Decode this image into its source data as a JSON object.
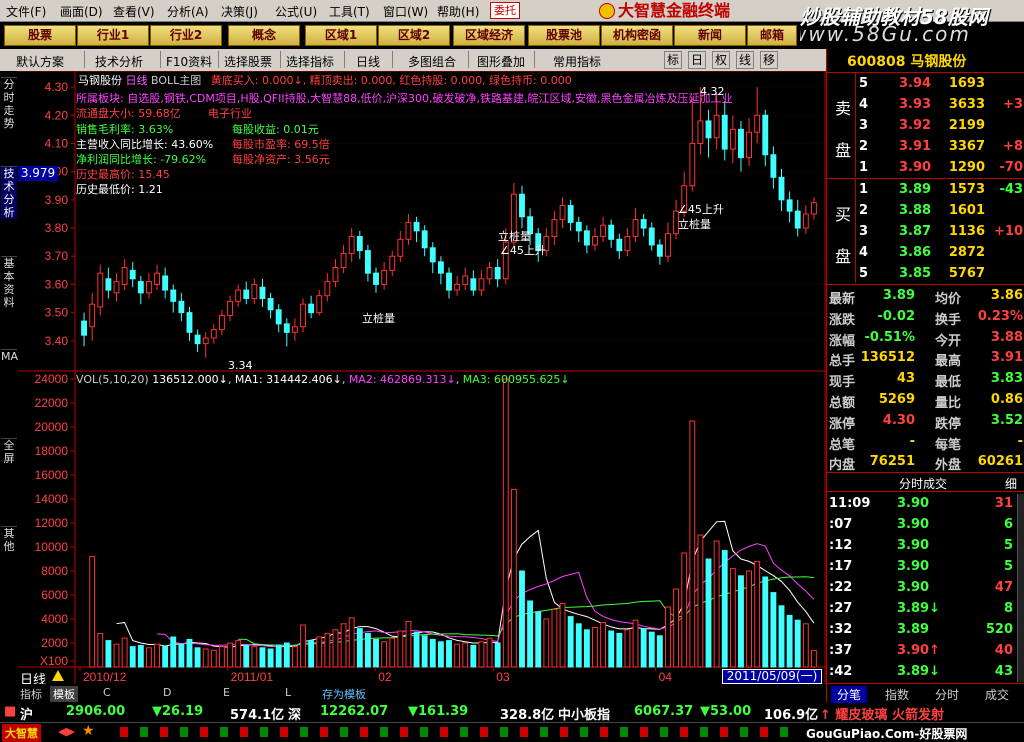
{
  "menu": [
    "文件(F)",
    "画面(D)",
    "查看(V)",
    "分析(A)",
    "决策(J)",
    "公式(U)",
    "工具(T)",
    "窗口(W)",
    "帮助(H)"
  ],
  "entrust_label": "委托",
  "brand_title": "大智慧金融终端",
  "watermark": {
    "line1": "炒股辅助教材58股网",
    "line2": "www.58Gu.com"
  },
  "func_buttons": [
    "股票",
    "行业1",
    "行业2",
    "概念",
    "区域1",
    "区域2",
    "区域经济",
    "股票池",
    "机构密函",
    "新闻",
    "邮箱"
  ],
  "toolbar": {
    "items": [
      "默认方案",
      "技术分析",
      "F10资料",
      "选择股票",
      "选择指标",
      "日线",
      "多图组合",
      "图形叠加",
      "常用指标"
    ],
    "toggles": [
      "标",
      "日",
      "权",
      "线",
      "移"
    ]
  },
  "left_tabs": [
    "分时走势",
    "技术分析",
    "基本资料",
    "MACD",
    "全屏",
    "其他"
  ],
  "chart_header": {
    "stock": "马钢股份",
    "period": "日线",
    "indicator": "BOLL主图",
    "signals": "黄底买入: 0.000↓, 精顶卖出: 0.000, 红色持股: 0.000, 绿色持币: 0.000"
  },
  "info_lines": {
    "sectors": "所属板块: 自选股,钢铁,CDM项目,H股,QFII持股,大智慧88,低价,沪深300,破发破净,铁路基建,皖江区域,安徽,黑色金属冶炼及压延加工业",
    "float_cap": "流通盘大小: 59.68亿",
    "tag": "电子行业",
    "gross_margin": "销售毛利率: 3.63%",
    "eps": "每股收益: 0.01元",
    "revenue_growth": "主营收入同比增长: 43.60%",
    "pe": "每股市盈率: 69.5倍",
    "profit_growth": "净利润同比增长: -79.62%",
    "nav": "每股净资产: 3.56元",
    "hist_high": "历史最高价: 15.45",
    "hist_low": "历史最低价: 1.21"
  },
  "current_price_tag": "3.979",
  "price_axis": [
    "4.30",
    "4.20",
    "4.10",
    "4.00",
    "3.90",
    "3.80",
    "3.70",
    "3.60",
    "3.50",
    "3.40"
  ],
  "vol_header": {
    "label": "VOL(5,10,20)",
    "value": "136512.000↓",
    "ma1": "MA1: 314442.406↓",
    "ma2": "MA2: 462869.313↓",
    "ma3": "MA3: 600955.625↓"
  },
  "vol_axis": [
    "24000",
    "22000",
    "20000",
    "18000",
    "16000",
    "14000",
    "12000",
    "10000",
    "8000",
    "6000",
    "4000",
    "2000",
    "X100"
  ],
  "chart_annotations": {
    "low_marker": "3.34",
    "high_marker": "4.32",
    "notes": [
      "立桩量",
      "立桩量",
      "∠45上升",
      "∠45上升",
      "立桩量"
    ]
  },
  "date_axis": [
    "2010/12",
    "2011/01",
    "02",
    "03",
    "04"
  ],
  "date_box": "2011/05/09(一)",
  "period_label": "日线",
  "bottom_tabs": [
    "指标",
    "模板",
    "C",
    "D",
    "E",
    "L",
    "存为模板"
  ],
  "ticker": {
    "sh_label": "沪",
    "sh_index": "2906.00",
    "sh_change": "▼26.19",
    "sh_amount": "574.1亿",
    "sz_label": "深",
    "sz_index": "12262.07",
    "sz_change": "▼161.39",
    "sz_amount": "328.8亿",
    "sme_label": "中小板指",
    "sme_index": "6067.37",
    "sme_change": "▼53.00",
    "sme_amount": "106.9亿",
    "news": "↑ 耀皮玻璃 火箭发射"
  },
  "status": {
    "logo": "大智慧",
    "site": "GouGuPiao.Com-好股票网"
  },
  "right_panel": {
    "code_name": "600808 马钢股份",
    "sell_label": [
      "卖",
      "盘"
    ],
    "buy_label": [
      "买",
      "盘"
    ],
    "asks": [
      {
        "level": "5",
        "price": "3.94",
        "vol": "1693",
        "chg": ""
      },
      {
        "level": "4",
        "price": "3.93",
        "vol": "3633",
        "chg": "+3"
      },
      {
        "level": "3",
        "price": "3.92",
        "vol": "2199",
        "chg": ""
      },
      {
        "level": "2",
        "price": "3.91",
        "vol": "3367",
        "chg": "+8"
      },
      {
        "level": "1",
        "price": "3.90",
        "vol": "1290",
        "chg": "-70"
      }
    ],
    "bids": [
      {
        "level": "1",
        "price": "3.89",
        "vol": "1573",
        "chg": "-43"
      },
      {
        "level": "2",
        "price": "3.88",
        "vol": "1601",
        "chg": ""
      },
      {
        "level": "3",
        "price": "3.87",
        "vol": "1136",
        "chg": "+10"
      },
      {
        "level": "4",
        "price": "3.86",
        "vol": "2872",
        "chg": ""
      },
      {
        "level": "5",
        "price": "3.85",
        "vol": "5767",
        "chg": ""
      }
    ],
    "stats": [
      {
        "l1": "最新",
        "v1": "3.89",
        "l2": "均价",
        "v2": "3.86"
      },
      {
        "l1": "涨跌",
        "v1": "-0.02",
        "l2": "换手",
        "v2": "0.23%"
      },
      {
        "l1": "涨幅",
        "v1": "-0.51%",
        "l2": "今开",
        "v2": "3.88"
      },
      {
        "l1": "总手",
        "v1": "136512",
        "l2": "最高",
        "v2": "3.91"
      },
      {
        "l1": "现手",
        "v1": "43",
        "l2": "最低",
        "v2": "3.83"
      },
      {
        "l1": "总额",
        "v1": "5269",
        "l2": "量比",
        "v2": "0.86"
      },
      {
        "l1": "涨停",
        "v1": "4.30",
        "l2": "跌停",
        "v2": "3.52"
      },
      {
        "l1": "总笔",
        "v1": "-",
        "l2": "每笔",
        "v2": "-"
      },
      {
        "l1": "内盘",
        "v1": "76251",
        "l2": "外盘",
        "v2": "60261"
      }
    ],
    "ticks_title": "分时成交",
    "ticks_detail": "细",
    "ticks": [
      {
        "time": "11:09",
        "price": "3.90",
        "vol": "31"
      },
      {
        "time": ":07",
        "price": "3.90",
        "vol": "6"
      },
      {
        "time": ":12",
        "price": "3.90",
        "vol": "5"
      },
      {
        "time": ":17",
        "price": "3.90",
        "vol": "5"
      },
      {
        "time": ":22",
        "price": "3.90",
        "vol": "47"
      },
      {
        "time": ":27",
        "price": "3.89↓",
        "vol": "8"
      },
      {
        "time": ":32",
        "price": "3.89",
        "vol": "520"
      },
      {
        "time": ":37",
        "price": "3.90↑",
        "vol": "40"
      },
      {
        "time": ":42",
        "price": "3.89↓",
        "vol": "43"
      }
    ],
    "tabs": [
      "分笔",
      "指数",
      "分时",
      "成交"
    ]
  },
  "chart_data": {
    "type": "candlestick+volume",
    "title": "马钢股份 日线",
    "price_range": [
      3.3,
      4.35
    ],
    "volume_range": [
      0,
      24500
    ],
    "volume_unit": "X100",
    "candles": [
      [
        3.47,
        3.42,
        3.5,
        3.38,
        0
      ],
      [
        3.45,
        3.53,
        3.57,
        3.4,
        9200
      ],
      [
        3.52,
        3.64,
        3.67,
        3.49,
        2800
      ],
      [
        3.62,
        3.58,
        3.66,
        3.55,
        2200
      ],
      [
        3.57,
        3.61,
        3.64,
        3.54,
        1900
      ],
      [
        3.6,
        3.66,
        3.69,
        3.58,
        2400
      ],
      [
        3.65,
        3.62,
        3.68,
        3.59,
        1700
      ],
      [
        3.61,
        3.57,
        3.63,
        3.53,
        1800
      ],
      [
        3.57,
        3.61,
        3.64,
        3.55,
        1600
      ],
      [
        3.6,
        3.64,
        3.67,
        3.58,
        1900
      ],
      [
        3.63,
        3.58,
        3.66,
        3.55,
        1700
      ],
      [
        3.58,
        3.54,
        3.6,
        3.5,
        2500
      ],
      [
        3.54,
        3.5,
        3.57,
        3.47,
        1900
      ],
      [
        3.5,
        3.43,
        3.52,
        3.4,
        2300
      ],
      [
        3.42,
        3.39,
        3.44,
        3.36,
        1600
      ],
      [
        3.39,
        3.41,
        3.43,
        3.34,
        1500
      ],
      [
        3.41,
        3.44,
        3.46,
        3.39,
        1400
      ],
      [
        3.44,
        3.49,
        3.51,
        3.42,
        1700
      ],
      [
        3.49,
        3.54,
        3.56,
        3.47,
        2000
      ],
      [
        3.54,
        3.58,
        3.6,
        3.52,
        2200
      ],
      [
        3.58,
        3.55,
        3.61,
        3.53,
        1800
      ],
      [
        3.55,
        3.6,
        3.62,
        3.53,
        1700
      ],
      [
        3.59,
        3.55,
        3.62,
        3.52,
        1600
      ],
      [
        3.55,
        3.51,
        3.57,
        3.48,
        1500
      ],
      [
        3.51,
        3.46,
        3.53,
        3.43,
        1800
      ],
      [
        3.46,
        3.43,
        3.48,
        3.38,
        2000
      ],
      [
        3.43,
        3.45,
        3.48,
        3.4,
        1700
      ],
      [
        3.45,
        3.53,
        3.55,
        3.43,
        3500
      ],
      [
        3.53,
        3.5,
        3.56,
        3.48,
        2200
      ],
      [
        3.5,
        3.56,
        3.58,
        3.49,
        2500
      ],
      [
        3.56,
        3.61,
        3.64,
        3.54,
        2800
      ],
      [
        3.61,
        3.66,
        3.69,
        3.59,
        3100
      ],
      [
        3.66,
        3.71,
        3.74,
        3.64,
        3600
      ],
      [
        3.71,
        3.77,
        3.8,
        3.68,
        4100
      ],
      [
        3.77,
        3.72,
        3.79,
        3.69,
        3200
      ],
      [
        3.72,
        3.64,
        3.74,
        3.61,
        2800
      ],
      [
        3.64,
        3.6,
        3.66,
        3.57,
        2300
      ],
      [
        3.6,
        3.65,
        3.68,
        3.58,
        2100
      ],
      [
        3.65,
        3.7,
        3.72,
        3.63,
        2400
      ],
      [
        3.7,
        3.76,
        3.79,
        3.68,
        3000
      ],
      [
        3.76,
        3.82,
        3.85,
        3.74,
        3800
      ],
      [
        3.82,
        3.79,
        3.84,
        3.75,
        2900
      ],
      [
        3.79,
        3.73,
        3.81,
        3.7,
        2600
      ],
      [
        3.73,
        3.68,
        3.75,
        3.64,
        2300
      ],
      [
        3.68,
        3.64,
        3.7,
        3.6,
        2100
      ],
      [
        3.64,
        3.58,
        3.66,
        3.55,
        2200
      ],
      [
        3.58,
        3.6,
        3.63,
        3.56,
        1900
      ],
      [
        3.6,
        3.63,
        3.66,
        3.58,
        2000
      ],
      [
        3.62,
        3.58,
        3.65,
        3.56,
        1800
      ],
      [
        3.58,
        3.62,
        3.65,
        3.56,
        2100
      ],
      [
        3.62,
        3.66,
        3.68,
        3.6,
        2400
      ],
      [
        3.66,
        3.62,
        3.69,
        3.59,
        2000
      ],
      [
        3.62,
        3.75,
        3.8,
        3.6,
        24000
      ],
      [
        3.75,
        3.92,
        3.96,
        3.73,
        14800
      ],
      [
        3.92,
        3.84,
        3.95,
        3.8,
        8000
      ],
      [
        3.84,
        3.78,
        3.87,
        3.74,
        5500
      ],
      [
        3.78,
        3.72,
        3.8,
        3.68,
        4600
      ],
      [
        3.72,
        3.77,
        3.8,
        3.7,
        4000
      ],
      [
        3.77,
        3.83,
        3.86,
        3.74,
        4800
      ],
      [
        3.83,
        3.88,
        3.91,
        3.8,
        5300
      ],
      [
        3.88,
        3.82,
        3.9,
        3.79,
        4200
      ],
      [
        3.82,
        3.79,
        3.84,
        3.75,
        3600
      ],
      [
        3.79,
        3.74,
        3.81,
        3.71,
        3100
      ],
      [
        3.74,
        3.77,
        3.8,
        3.72,
        3300
      ],
      [
        3.77,
        3.81,
        3.84,
        3.75,
        3700
      ],
      [
        3.81,
        3.76,
        3.83,
        3.73,
        3000
      ],
      [
        3.76,
        3.72,
        3.78,
        3.69,
        2800
      ],
      [
        3.72,
        3.77,
        3.8,
        3.7,
        3100
      ],
      [
        3.77,
        3.83,
        3.87,
        3.75,
        3900
      ],
      [
        3.83,
        3.8,
        3.85,
        3.77,
        3200
      ],
      [
        3.8,
        3.74,
        3.82,
        3.72,
        2900
      ],
      [
        3.74,
        3.7,
        3.76,
        3.67,
        2600
      ],
      [
        3.7,
        3.78,
        3.82,
        3.68,
        5000
      ],
      [
        3.78,
        3.86,
        3.9,
        3.76,
        6500
      ],
      [
        3.86,
        3.95,
        4.0,
        3.84,
        9500
      ],
      [
        3.95,
        4.1,
        4.26,
        3.93,
        20500
      ],
      [
        4.1,
        4.18,
        4.3,
        4.06,
        11000
      ],
      [
        4.18,
        4.12,
        4.22,
        4.05,
        9000
      ],
      [
        4.12,
        4.2,
        4.28,
        4.08,
        10500
      ],
      [
        4.2,
        4.08,
        4.25,
        4.04,
        9700
      ],
      [
        4.08,
        4.15,
        4.2,
        4.03,
        8200
      ],
      [
        4.15,
        4.05,
        4.18,
        4.0,
        7600
      ],
      [
        4.05,
        4.14,
        4.19,
        4.02,
        8000
      ],
      [
        4.14,
        4.2,
        4.3,
        4.1,
        8800
      ],
      [
        4.2,
        4.06,
        4.22,
        4.02,
        7500
      ],
      [
        4.06,
        3.98,
        4.09,
        3.94,
        6200
      ],
      [
        3.98,
        3.9,
        4.01,
        3.86,
        5100
      ],
      [
        3.9,
        3.86,
        3.93,
        3.82,
        4300
      ],
      [
        3.86,
        3.8,
        3.9,
        3.77,
        3900
      ],
      [
        3.8,
        3.85,
        3.88,
        3.78,
        3600
      ],
      [
        3.85,
        3.89,
        3.91,
        3.83,
        1365
      ]
    ]
  }
}
